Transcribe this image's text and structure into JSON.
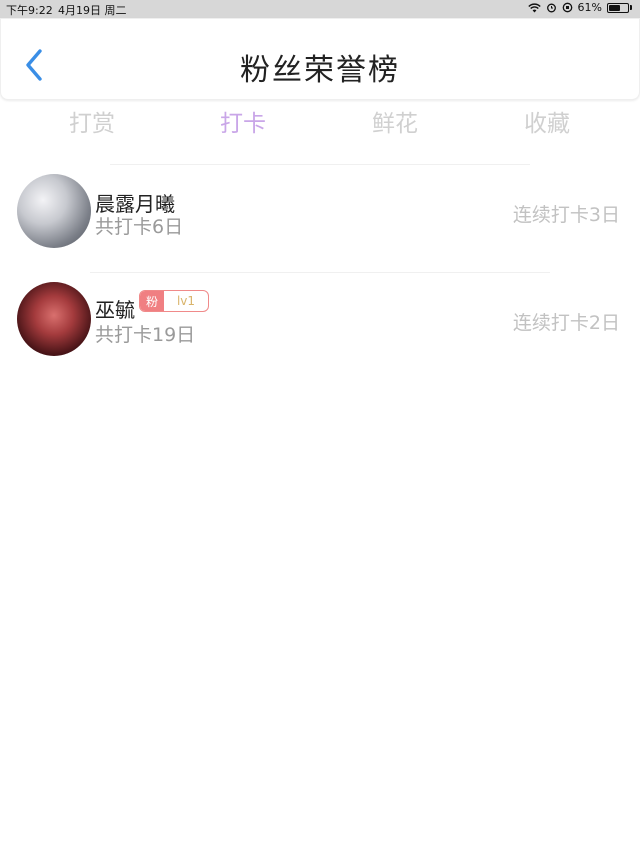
{
  "status_bar": {
    "time": "下午9:22",
    "date": "4月19日 周二",
    "battery_percent": "61%",
    "battery_level": 0.61
  },
  "header": {
    "title": "粉丝荣誉榜",
    "back_icon": "chevron-left-icon",
    "back_color": "#3a8ee6"
  },
  "tabs": [
    {
      "label": "打赏",
      "active": false
    },
    {
      "label": "打卡",
      "active": true
    },
    {
      "label": "鲜花",
      "active": false
    },
    {
      "label": "收藏",
      "active": false
    }
  ],
  "colors": {
    "active_tab": "#c9a6e8",
    "inactive_tab": "#d0d0d0",
    "badge": "#f07f82"
  },
  "list": [
    {
      "name": "晨露月曦",
      "sub": "共打卡6日",
      "streak": "连续打卡3日",
      "badge": null
    },
    {
      "name": "巫毓",
      "sub": "共打卡19日",
      "streak": "连续打卡2日",
      "badge": {
        "tag": "粉",
        "level": "lv1"
      }
    }
  ]
}
